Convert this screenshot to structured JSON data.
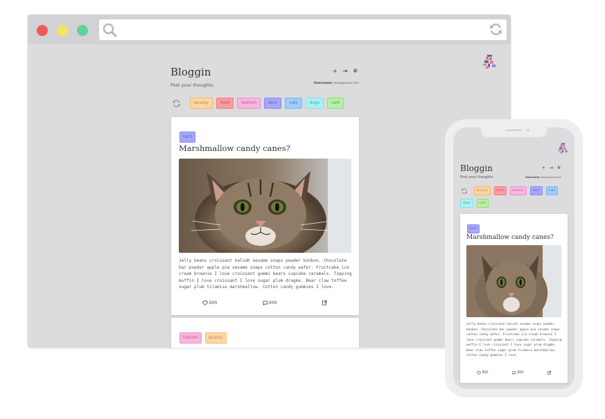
{
  "app": {
    "name": "Bloggin",
    "tagline": "Post your thoughts.",
    "username_label": "Username:",
    "username_value": "wowapwow.com"
  },
  "header_icons": {
    "add": "+",
    "logout": "⇥",
    "settings": "✲"
  },
  "tags": [
    {
      "label": "beauty",
      "bg": "#fdd7a6",
      "border": "#f7b766",
      "color": "#c6893f"
    },
    {
      "label": "food",
      "bg": "#fb9ca3",
      "border": "#f27a83",
      "color": "#c84a55"
    },
    {
      "label": "fashion",
      "bg": "#f9b6de",
      "border": "#ec8fc7",
      "color": "#bd5796"
    },
    {
      "label": "tech",
      "bg": "#a7a8f6",
      "border": "#8689ee",
      "color": "#5b5ec8"
    },
    {
      "label": "cats",
      "bg": "#9fcdf7",
      "border": "#77b3ee",
      "color": "#3f7fc2"
    },
    {
      "label": "dogs",
      "bg": "#abf1f3",
      "border": "#82e0e4",
      "color": "#3aa9ad"
    },
    {
      "label": "rant",
      "bg": "#b7f0a6",
      "border": "#8edf77",
      "color": "#4fa33a"
    }
  ],
  "post": {
    "tag": "tech",
    "title": "Marshmallow candy canes?",
    "body": "Jelly beans croissant halvah sesame snaps powder bonbon. Chocolate bar powder apple pie sesame snaps cotton candy wafer. Fruitcake ice cream brownie I love croissant gummi bears cupcake caramels. Topping muffin I love croissant I love sugar plum dragée. Bear claw toffee sugar plum tiramisu marshmallow. Cotton candy gummies I love.",
    "likes": "300",
    "comments": "300"
  },
  "post2": {
    "tags": [
      "fashion",
      "beauty"
    ]
  },
  "colors": {
    "background": "#dcdcde",
    "chrome": "#d2d2d4",
    "close": "#f05a5b",
    "minimize": "#f3e55b",
    "maximize": "#5fd29a"
  },
  "icons": {
    "search": "search-icon",
    "reload": "reload-icon",
    "refresh": "refresh-icon",
    "heart": "heart-icon",
    "comment": "comment-icon",
    "edit": "edit-icon",
    "avatar": "avatar-icon"
  }
}
